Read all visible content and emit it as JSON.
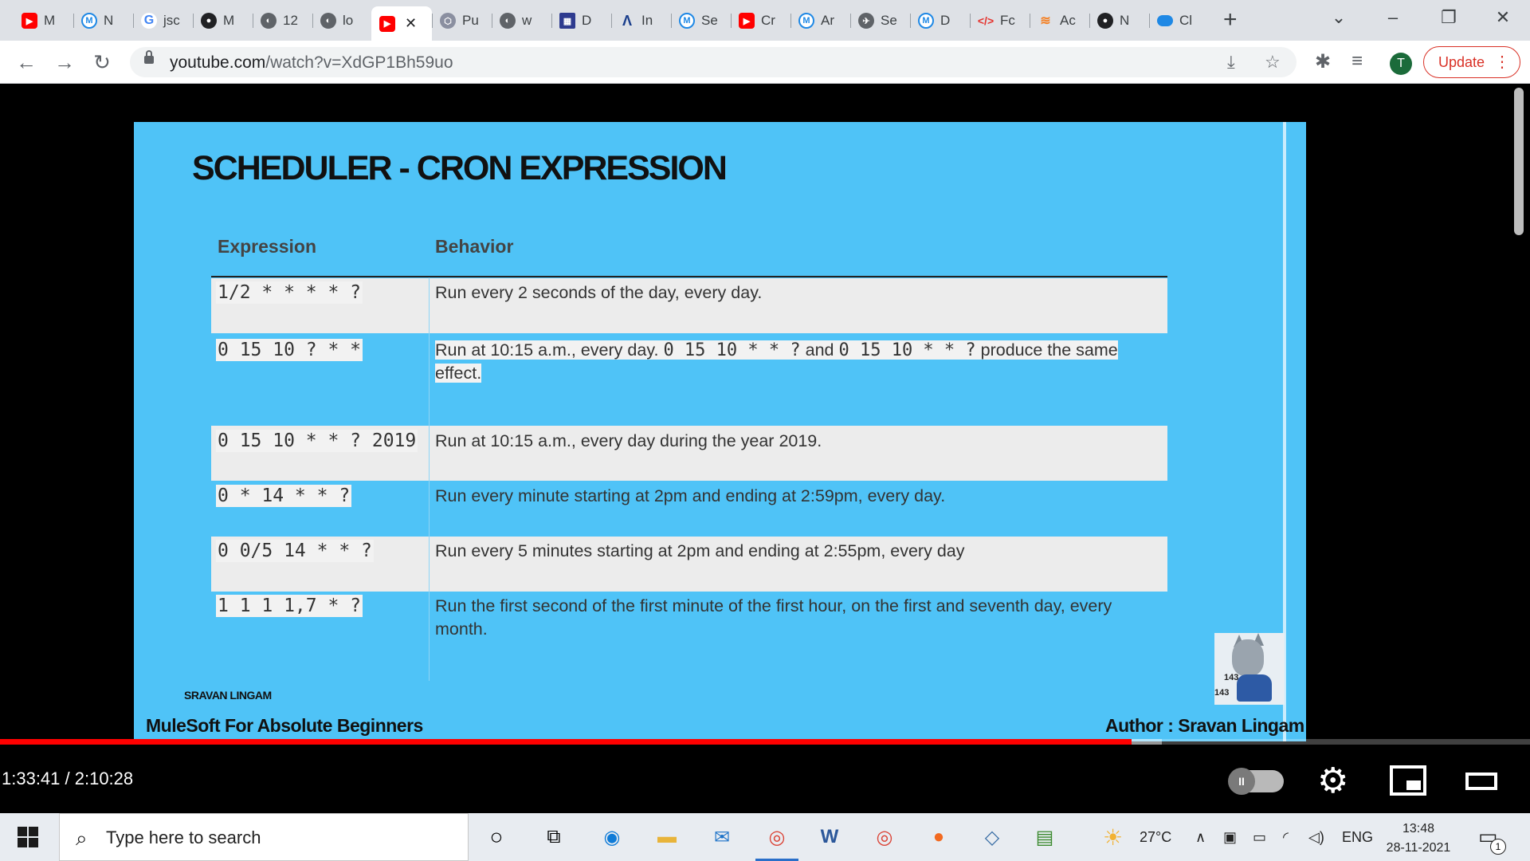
{
  "browser": {
    "tabs": [
      {
        "label": "M",
        "icon": "youtube-icon"
      },
      {
        "label": "N",
        "icon": "mulesoft-icon"
      },
      {
        "label": "jsc",
        "icon": "google-icon"
      },
      {
        "label": "M",
        "icon": "github-icon"
      },
      {
        "label": "12",
        "icon": "globe-icon"
      },
      {
        "label": "lo",
        "icon": "globe-icon"
      },
      {
        "label": "",
        "icon": "youtube-icon",
        "active": true
      },
      {
        "label": "Pu",
        "icon": "puzzle-site-icon"
      },
      {
        "label": "w",
        "icon": "globe-icon"
      },
      {
        "label": "D",
        "icon": "dt-icon"
      },
      {
        "label": "In",
        "icon": "mk-icon"
      },
      {
        "label": "Se",
        "icon": "mulesoft-icon"
      },
      {
        "label": "Cr",
        "icon": "youtube-icon"
      },
      {
        "label": "Ar",
        "icon": "mulesoft-icon"
      },
      {
        "label": "Se",
        "icon": "bird-icon"
      },
      {
        "label": "D",
        "icon": "mulesoft-icon"
      },
      {
        "label": "Fc",
        "icon": "code-icon"
      },
      {
        "label": "Ac",
        "icon": "stackoverflow-icon"
      },
      {
        "label": "N",
        "icon": "github-icon"
      },
      {
        "label": "Cl",
        "icon": "cloud-icon"
      }
    ],
    "active_tab_close": "✕",
    "new_tab": "+",
    "url_host": "youtube.com",
    "url_path": "/watch?v=XdGP1Bh59uo",
    "profile_initial": "T",
    "update_label": "Update"
  },
  "slide": {
    "title": "SCHEDULER - CRON EXPRESSION",
    "col_expression": "Expression",
    "col_behavior": "Behavior",
    "rows": [
      {
        "expr": "1/2 * * * * ?",
        "behavior": "Run every 2 seconds of the day, every day."
      },
      {
        "expr": "0 15 10 ? * *",
        "behavior_a": "Run at 10:15 a.m., every day.",
        "behavior_code1": "0 15 10 * * ?",
        "behavior_b": "and",
        "behavior_code2": "0 15 10 * * ?",
        "behavior_c": "produce the same effect."
      },
      {
        "expr": "0 15 10 * * ? 2019",
        "behavior": "Run at 10:15 a.m., every day during the year 2019."
      },
      {
        "expr": "0 * 14 * * ?",
        "behavior": "Run every minute starting at 2pm and ending at 2:59pm, every day."
      },
      {
        "expr": "0 0/5 14 * * ?",
        "behavior": "Run every 5 minutes starting at 2pm and ending at 2:55pm, every day"
      },
      {
        "expr": "1 1 1 1,7 * ?",
        "behavior": "Run the first second of the first minute of the first hour, on the first and seventh day, every month."
      }
    ],
    "watermark_author": "SRAVAN LINGAM",
    "mascot_num_1": "143",
    "mascot_num_2": "143",
    "course_banner": "MuleSoft For Absolute Beginners",
    "author_banner": "Author : Sravan Lingam"
  },
  "player": {
    "time_display": "1:33:41 / 2:10:28",
    "played_fraction": 0.7397,
    "buffered_fraction": 0.7592
  },
  "taskbar": {
    "search_placeholder": "Type here to search",
    "weather_temp": "27°C",
    "language": "ENG",
    "time": "13:48",
    "date": "28-11-2021",
    "notification_count": "1"
  }
}
